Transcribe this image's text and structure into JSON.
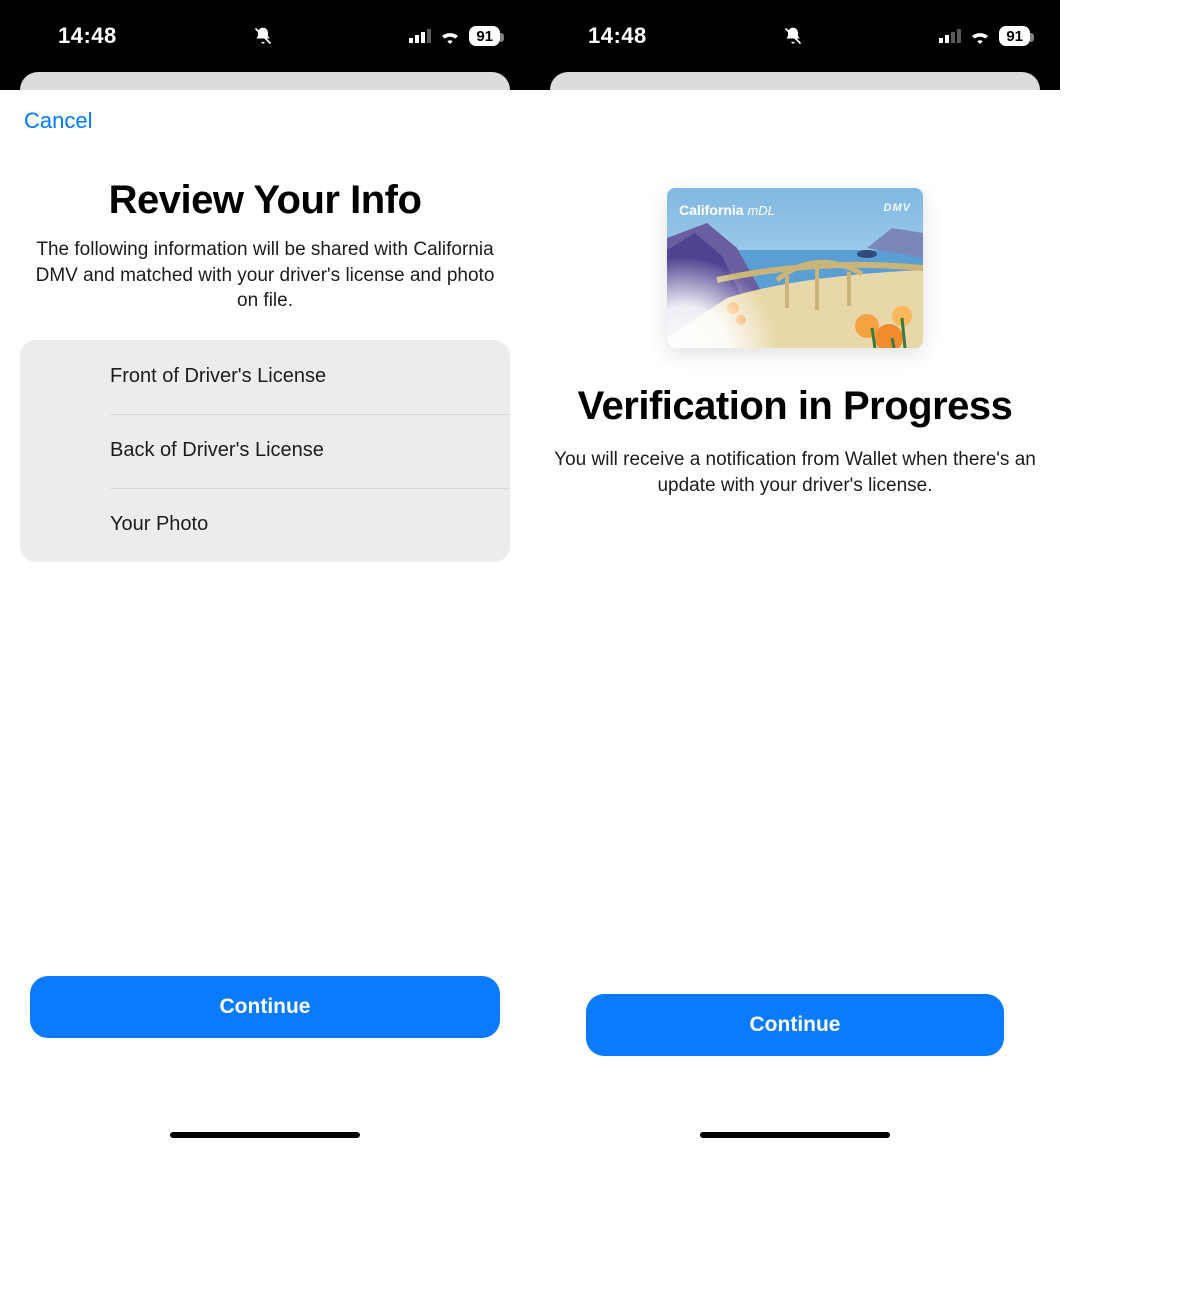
{
  "statusbar": {
    "time": "14:48",
    "battery_pct": "91"
  },
  "left": {
    "nav": {
      "cancel_label": "Cancel"
    },
    "title": "Review Your Info",
    "subtitle": "The following information will be shared with California DMV and matched with your driver's license and photo on file.",
    "rows": {
      "front": "Front of Driver's License",
      "back": "Back of Driver's License",
      "photo": "Your Photo"
    },
    "cta": "Continue"
  },
  "right": {
    "card_title": "California",
    "card_sub": "mDL",
    "card_issuer": "DMV",
    "title": "Verification in Progress",
    "subtitle": "You will receive a notification from Wallet when there's an update with your driver's license.",
    "cta": "Continue"
  }
}
